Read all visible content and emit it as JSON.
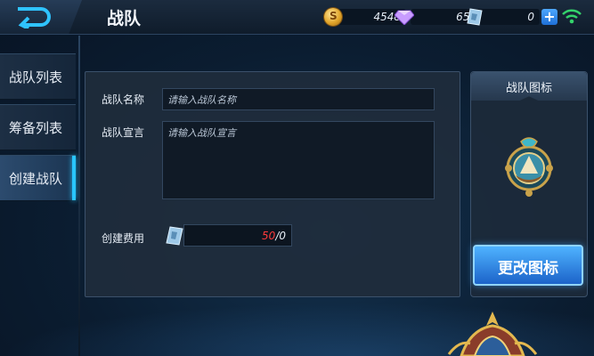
{
  "header": {
    "title": "战队",
    "gold": "4548",
    "diamonds": "659",
    "vouchers": "0",
    "plus_label": "+"
  },
  "sidebar": {
    "items": [
      {
        "label": "战队列表"
      },
      {
        "label": "筹备列表"
      },
      {
        "label": "创建战队"
      }
    ]
  },
  "form": {
    "name_label": "战队名称",
    "name_placeholder": "请输入战队名称",
    "declaration_label": "战队宣言",
    "declaration_placeholder": "请输入战队宣言",
    "fee_label": "创建费用",
    "fee_cost": "50",
    "fee_owned": "/0"
  },
  "icon_panel": {
    "header": "战队图标",
    "change_button": "更改图标"
  },
  "colors": {
    "accent": "#29c6ff",
    "button": "#2d86e8",
    "insufficient": "#ff3b3b"
  }
}
